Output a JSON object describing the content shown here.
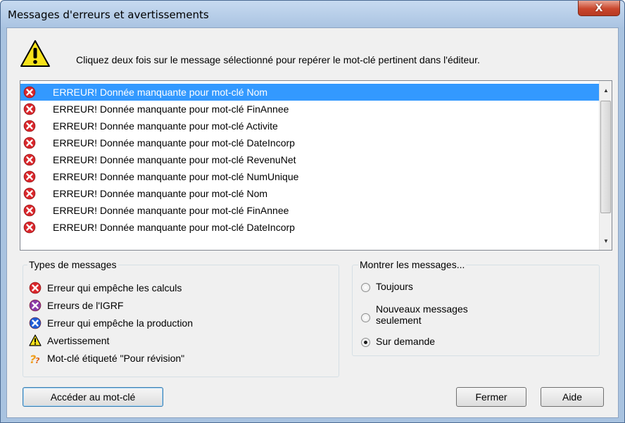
{
  "window": {
    "title": "Messages d'erreurs et avertissements",
    "close_label": "X"
  },
  "instruction": "Cliquez deux fois sur le message sélectionné pour repérer le mot-clé pertinent dans l'éditeur.",
  "messages": [
    {
      "text": "ERREUR! Donnée manquante pour mot-clé Nom",
      "icon": "error-icon",
      "selected": true
    },
    {
      "text": "ERREUR! Donnée manquante pour mot-clé FinAnnee",
      "icon": "error-icon"
    },
    {
      "text": "ERREUR! Donnée manquante pour mot-clé Activite",
      "icon": "error-icon"
    },
    {
      "text": "ERREUR! Donnée manquante pour mot-clé DateIncorp",
      "icon": "error-icon"
    },
    {
      "text": "ERREUR! Donnée manquante pour mot-clé RevenuNet",
      "icon": "error-icon"
    },
    {
      "text": "ERREUR! Donnée manquante pour mot-clé NumUnique",
      "icon": "error-icon"
    },
    {
      "text": "ERREUR! Donnée manquante pour mot-clé Nom",
      "icon": "error-icon"
    },
    {
      "text": "ERREUR! Donnée manquante pour mot-clé FinAnnee",
      "icon": "error-icon"
    },
    {
      "text": "ERREUR! Donnée manquante pour mot-clé DateIncorp",
      "icon": "error-icon"
    }
  ],
  "types": {
    "legend": "Types de messages",
    "items": [
      {
        "label": "Erreur qui empêche les calculs",
        "icon": "red-error-icon"
      },
      {
        "label": "Erreurs de l'IGRF",
        "icon": "purple-error-icon"
      },
      {
        "label": "Erreur qui empêche la production",
        "icon": "blue-error-icon"
      },
      {
        "label": "Avertissement",
        "icon": "warning-icon"
      },
      {
        "label": "Mot-clé étiqueté \"Pour révision\"",
        "icon": "review-icon"
      }
    ]
  },
  "show": {
    "legend": "Montrer les messages...",
    "options": [
      {
        "label": "Toujours",
        "checked": false
      },
      {
        "label": "Nouveaux messages\nseulement",
        "checked": false
      },
      {
        "label": "Sur demande",
        "checked": true
      }
    ]
  },
  "buttons": {
    "goto": "Accéder au mot-clé",
    "close": "Fermer",
    "help": "Aide"
  },
  "colors": {
    "selection": "#3399ff",
    "error_red": "#d9262b",
    "error_purple": "#8a3aa8",
    "error_blue": "#1e5cd6",
    "warning_yellow": "#f7e21b"
  }
}
